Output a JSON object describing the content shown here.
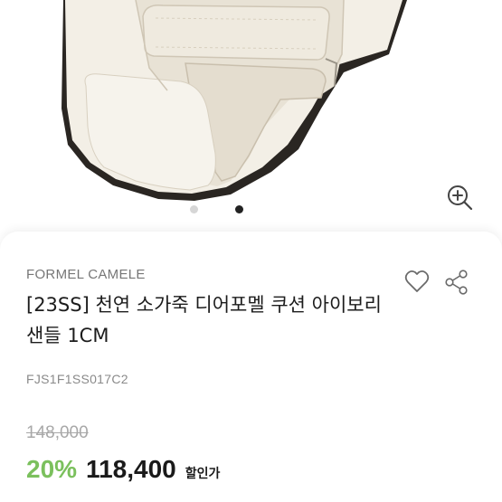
{
  "product": {
    "brand": "FORMEL CAMELE",
    "title": "[23SS] 천연 소가죽 디어포멜 쿠션 아이보리 샌들 1CM",
    "sku": "FJS1F1SS017C2"
  },
  "price": {
    "original": "148,000",
    "discount": "20%",
    "sale": "118,400",
    "sale_label": "할인가"
  },
  "carousel": {
    "current": 2,
    "total": 2
  },
  "icons": {
    "zoom": "zoom-in-icon",
    "like": "heart-outline-icon",
    "share": "share-icon"
  },
  "colors": {
    "discount": "#7bc05d",
    "sandal": "#ece7dc",
    "dot_active": "#222222",
    "dot_inactive": "#d6d6d6"
  }
}
